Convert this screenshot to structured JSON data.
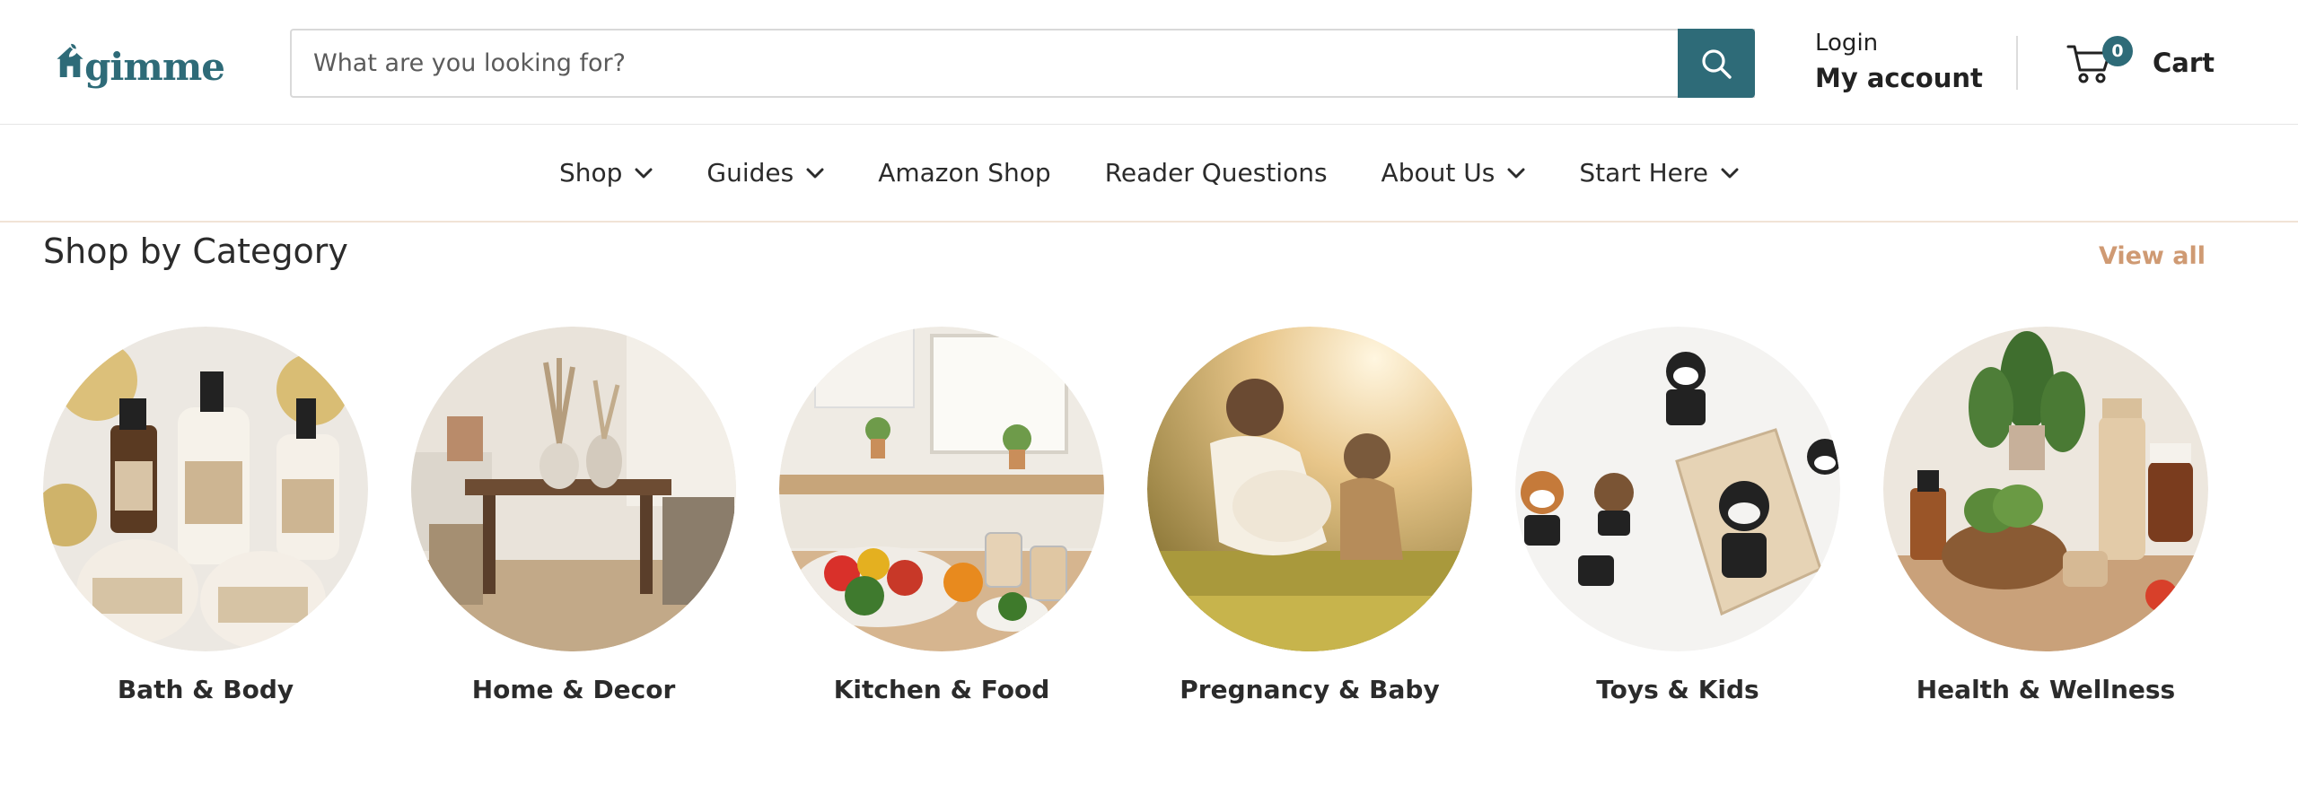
{
  "brand": {
    "logo_text": "gimme",
    "logo_icon": "house-leaf-icon",
    "accent": "#2e6b78"
  },
  "search": {
    "placeholder": "What are you looking for?",
    "icon": "search-icon"
  },
  "account": {
    "login_label": "Login",
    "my_account_label": "My account"
  },
  "cart": {
    "count": "0",
    "label": "Cart",
    "icon": "cart-icon"
  },
  "nav": {
    "items": [
      {
        "label": "Shop",
        "has_dropdown": true
      },
      {
        "label": "Guides",
        "has_dropdown": true
      },
      {
        "label": "Amazon Shop",
        "has_dropdown": false
      },
      {
        "label": "Reader Questions",
        "has_dropdown": false
      },
      {
        "label": "About Us",
        "has_dropdown": true
      },
      {
        "label": "Start Here",
        "has_dropdown": true
      }
    ]
  },
  "section": {
    "title": "Shop by Category",
    "view_all": "View all",
    "view_all_color": "#cf9a73"
  },
  "categories": [
    {
      "label": "Bath & Body"
    },
    {
      "label": "Home & Decor"
    },
    {
      "label": "Kitchen & Food"
    },
    {
      "label": "Pregnancy & Baby"
    },
    {
      "label": "Toys & Kids"
    },
    {
      "label": "Health & Wellness"
    }
  ]
}
